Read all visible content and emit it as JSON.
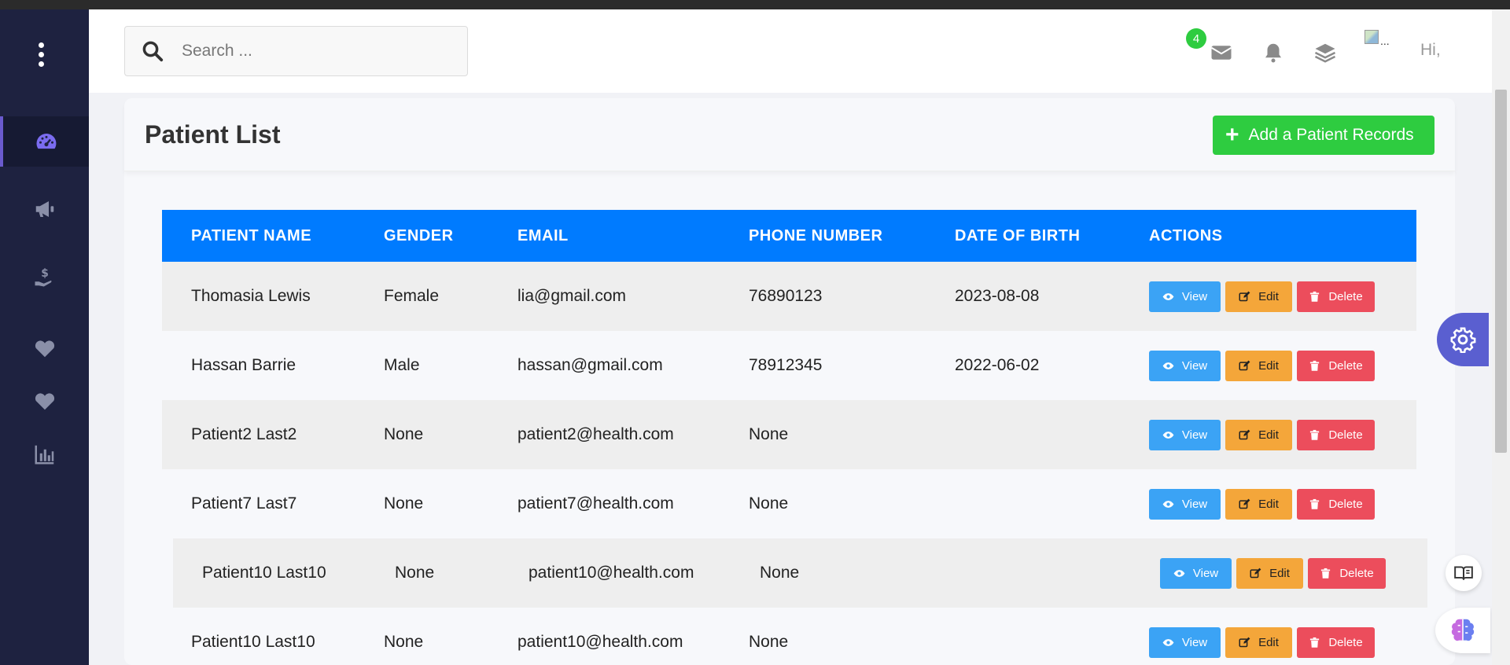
{
  "search": {
    "placeholder": "Search ..."
  },
  "topbar": {
    "notification_count": "4",
    "avatar_alt": "...",
    "greeting": "Hi,"
  },
  "sidebar": {
    "items": [
      {
        "icon": "dashboard-gauge-icon",
        "active": true
      },
      {
        "icon": "megaphone-icon",
        "active": false
      },
      {
        "icon": "hand-holding-dollar-icon",
        "active": false
      },
      {
        "icon": "heart-icon",
        "active": false
      },
      {
        "icon": "heart-icon",
        "active": false
      },
      {
        "icon": "bar-chart-icon",
        "active": false
      }
    ]
  },
  "page": {
    "title": "Patient List",
    "add_button_label": "Add a Patient Records"
  },
  "table": {
    "headers": [
      "PATIENT NAME",
      "GENDER",
      "EMAIL",
      "PHONE NUMBER",
      "DATE OF BIRTH",
      "ACTIONS"
    ],
    "rows": [
      {
        "name": "Thomasia Lewis",
        "gender": "Female",
        "email": "lia@gmail.com",
        "phone": "76890123",
        "dob": "2023-08-08"
      },
      {
        "name": "Hassan Barrie",
        "gender": "Male",
        "email": "hassan@gmail.com",
        "phone": "78912345",
        "dob": "2022-06-02"
      },
      {
        "name": "Patient2 Last2",
        "gender": "None",
        "email": "patient2@health.com",
        "phone": "None",
        "dob": ""
      },
      {
        "name": "Patient7 Last7",
        "gender": "None",
        "email": "patient7@health.com",
        "phone": "None",
        "dob": ""
      },
      {
        "name": "Patient10 Last10",
        "gender": "None",
        "email": "patient10@health.com",
        "phone": "None",
        "dob": ""
      },
      {
        "name": "Patient10 Last10",
        "gender": "None",
        "email": "patient10@health.com",
        "phone": "None",
        "dob": ""
      }
    ],
    "actions": {
      "view": "View",
      "edit": "Edit",
      "delete": "Delete"
    }
  },
  "colors": {
    "sidebar": "#1e2240",
    "table_header": "#007bff",
    "add_button": "#2ecc40",
    "view_button": "#3ba3f5",
    "edit_button": "#f4a63a",
    "delete_button": "#ec4d5c",
    "settings_fab": "#5a5fd0"
  }
}
